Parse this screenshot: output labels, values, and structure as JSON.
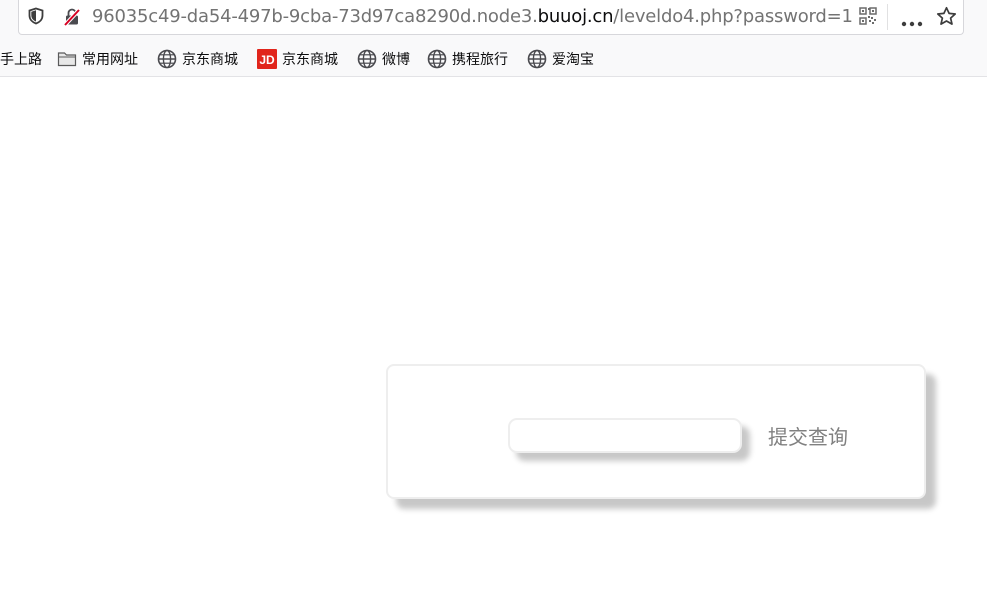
{
  "browser": {
    "url": {
      "prefix": "96035c49-da54-497b-9cba-73d97ca8290d.node3.",
      "domain": "buuoj.cn",
      "path": "/leveldo4.php?password=1"
    },
    "icons": {
      "shield": "shield-icon",
      "insecure_lock": "insecure-lock-icon",
      "qr": "qr-code-icon",
      "more": "more-options-icon",
      "bookmark_star": "bookmark-star-icon"
    },
    "bookmarks": [
      {
        "label": "手上路",
        "icon": "none"
      },
      {
        "label": "常用网址",
        "icon": "folder-icon"
      },
      {
        "label": "京东商城",
        "icon": "globe-icon"
      },
      {
        "label": "京东商城",
        "icon": "jd-logo-icon"
      },
      {
        "label": "微博",
        "icon": "globe-icon"
      },
      {
        "label": "携程旅行",
        "icon": "globe-icon"
      },
      {
        "label": "爱淘宝",
        "icon": "globe-icon"
      }
    ]
  },
  "page": {
    "form": {
      "input_value": "",
      "submit_label": "提交查询"
    }
  },
  "colors": {
    "jd_red": "#e1251b",
    "insecure_red": "#d70022",
    "card_border": "#eeeeee",
    "button_text": "#808080"
  }
}
